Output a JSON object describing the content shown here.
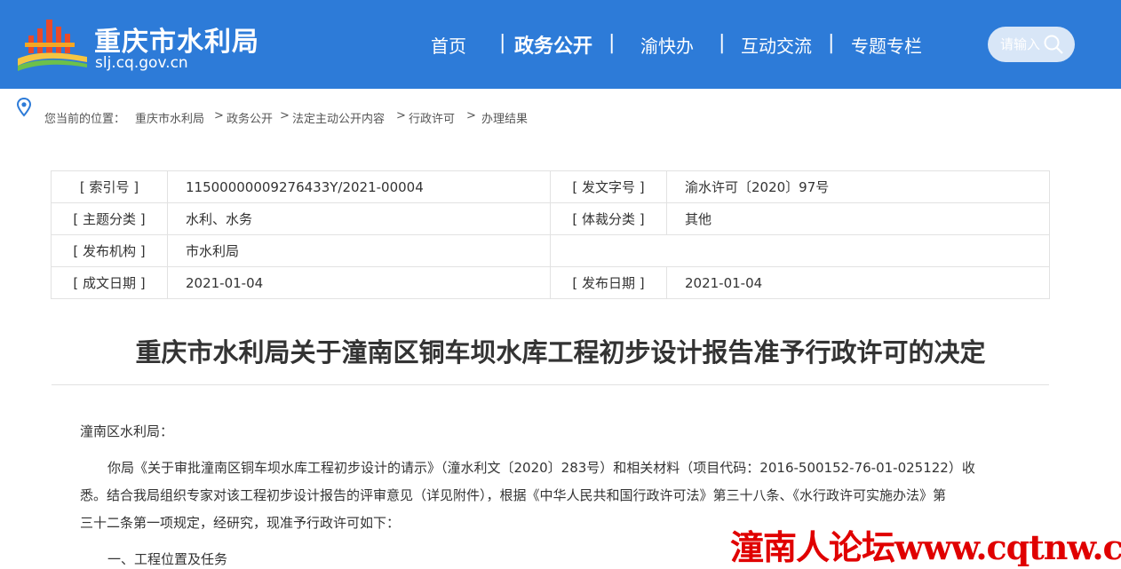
{
  "header": {
    "site_name": "重庆市水利局",
    "site_domain": "slj.cq.gov.cn",
    "nav": [
      {
        "label": "首页"
      },
      {
        "label": "政务公开"
      },
      {
        "label": "渝快办"
      },
      {
        "label": "互动交流"
      },
      {
        "label": "专题专栏"
      }
    ],
    "nav_separator": "|",
    "search_placeholder": "请输入"
  },
  "breadcrumb": {
    "label": "您当前的位置：",
    "items": [
      "重庆市水利局",
      "政务公开",
      "法定主动公开内容",
      "行政许可",
      "办理结果"
    ],
    "separator": ">"
  },
  "meta": {
    "index_label": "[ 索引号 ]",
    "index_value": "11500000009276433Y/2021-00004",
    "doc_no_label": "[ 发文字号 ]",
    "doc_no_value": "渝水许可〔2020〕97号",
    "topic_label": "[ 主题分类 ]",
    "topic_value": "水利、水务",
    "genre_label": "[ 体裁分类 ]",
    "genre_value": "其他",
    "issuer_label": "[ 发布机构 ]",
    "issuer_value": "市水利局",
    "written_label": "[ 成文日期 ]",
    "written_value": "2021-01-04",
    "published_label": "[ 发布日期 ]",
    "published_value": "2021-01-04"
  },
  "document": {
    "title": "重庆市水利局关于潼南区铜车坝水库工程初步设计报告准予行政许可的决定",
    "salutation": "潼南区水利局：",
    "para1_line1": "你局《关于审批潼南区铜车坝水库工程初步设计的请示》（潼水利文〔2020〕283号）和相关材料（项目代码：2016-500152-76-01-025122）收",
    "para1_line2": "悉。结合我局组织专家对该工程初步设计报告的评审意见（详见附件），根据《中华人民共和国行政许可法》第三十八条、《水行政许可实施办法》第",
    "para1_line3": "三十二条第一项规定，经研究，现准予行政许可如下：",
    "section1": "一、工程位置及任务"
  },
  "watermark": "潼南人论坛www.cqtnw.cn",
  "colors": {
    "header_bg": "#2d7bd8",
    "watermark": "#e00000"
  }
}
